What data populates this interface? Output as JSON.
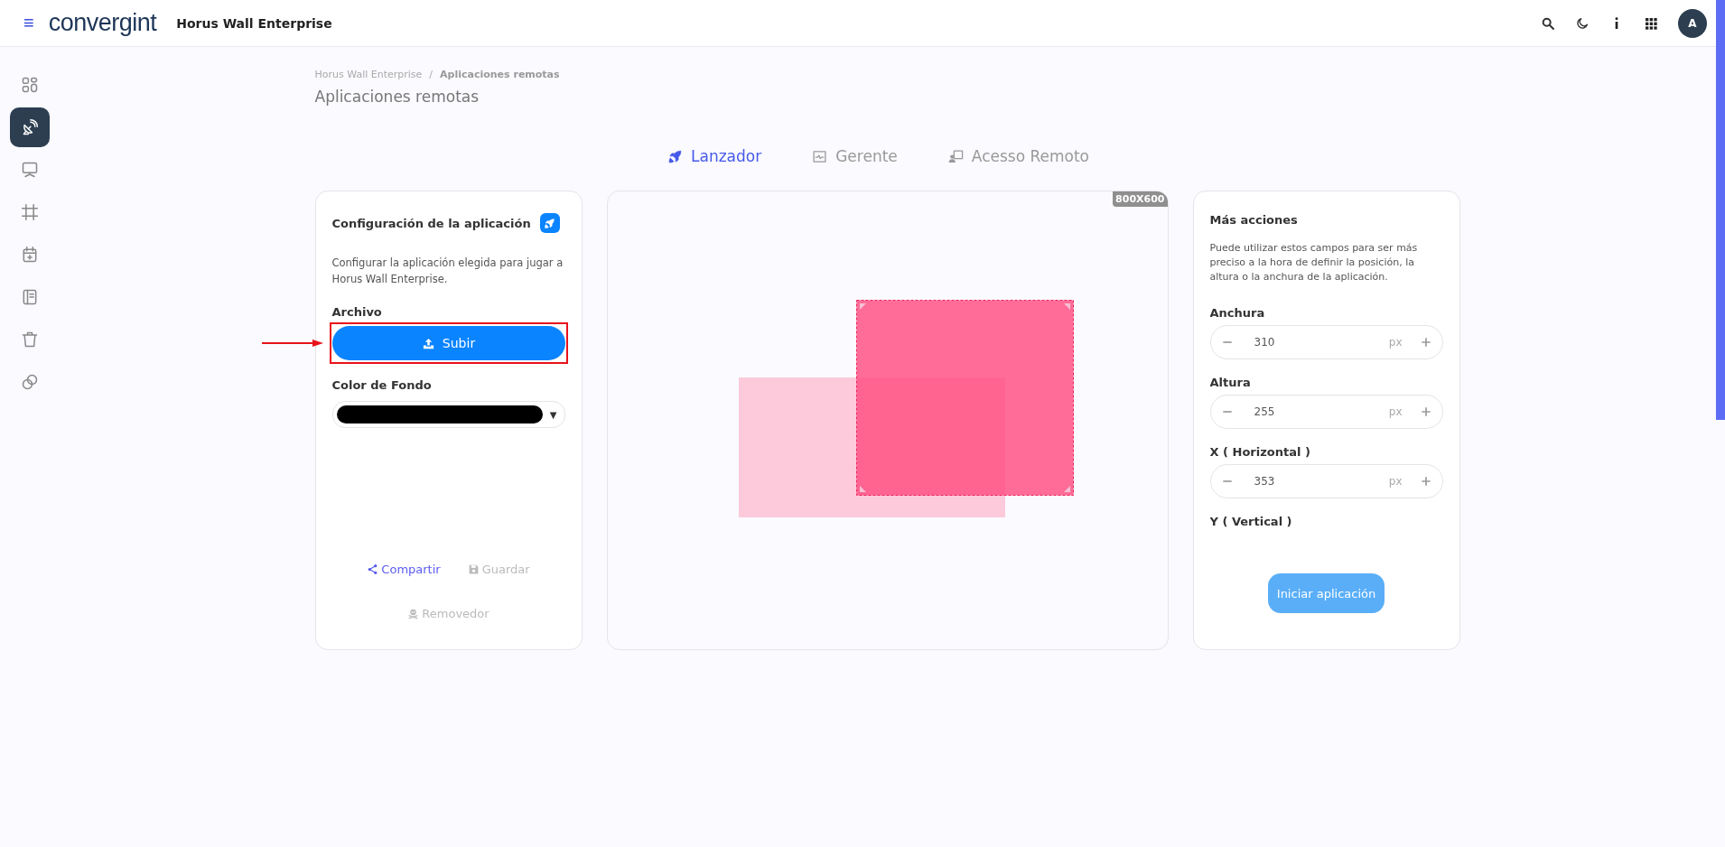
{
  "top_bar": {
    "menu_glyph": "≡",
    "logo": "convergint",
    "app_name": "Horus Wall Enterprise",
    "avatar": "A"
  },
  "sidebar": {
    "items": [
      {
        "selected": false
      },
      {
        "selected": true
      },
      {
        "selected": false
      },
      {
        "selected": false
      },
      {
        "selected": false
      },
      {
        "selected": false
      },
      {
        "selected": false
      },
      {
        "selected": false
      }
    ]
  },
  "breadcrumb": {
    "items": [
      {
        "label": "Horus Wall Enterprise",
        "current": false
      },
      {
        "label": "Aplicaciones remotas",
        "current": true
      }
    ],
    "separator": "/"
  },
  "page_title": "Aplicaciones remotas",
  "tabs": [
    {
      "label": "Lanzador",
      "selected": true
    },
    {
      "label": "Gerente",
      "selected": false
    },
    {
      "label": "Acesso Remoto",
      "selected": false
    }
  ],
  "config_card": {
    "title": "Configuración de la aplicación",
    "description": "Configurar la aplicación elegida para jugar a Horus Wall Enterprise.",
    "file_label": "Archivo",
    "upload_button": {
      "label": "Subir",
      "highlighted": true
    },
    "color_label": "Color de Fondo",
    "background_color": {
      "color": "#000000",
      "caret": "▼"
    },
    "actions": [
      {
        "label": "Compartir",
        "disabled": false
      },
      {
        "label": "Guardar",
        "disabled": true
      },
      {
        "label": "Removedor",
        "disabled": true
      }
    ]
  },
  "preview": {
    "resolution": "800X600"
  },
  "more_card": {
    "title": "Más acciones",
    "description": "Puede utilizar estos campos para ser más preciso a la hora de definir la posición, la altura o la anchura de la aplicación.",
    "fields": [
      {
        "label": "Anchura",
        "value": "310",
        "unit": "px"
      },
      {
        "label": "Altura",
        "value": "255",
        "unit": "px"
      },
      {
        "label": "X ( Horizontal )",
        "value": "353",
        "unit": "px"
      }
    ],
    "next_label": "Y ( Vertical )",
    "start_button": {
      "label": "Iniciar aplicación",
      "disabled": true
    }
  }
}
